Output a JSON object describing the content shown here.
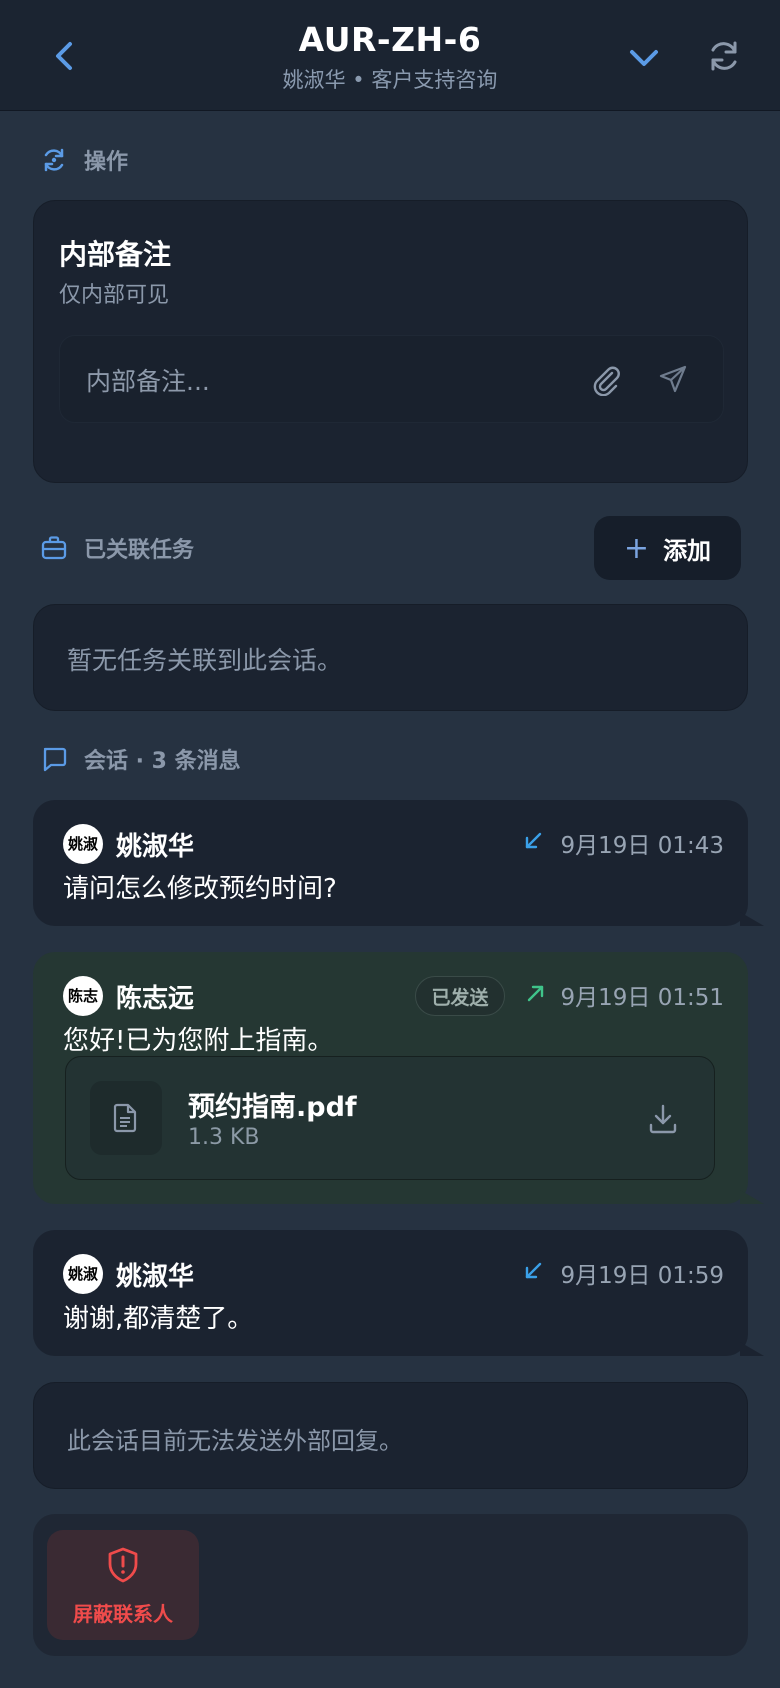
{
  "header": {
    "title": "AUR-ZH-6",
    "subtitle": "姚淑华 • 客户支持咨询"
  },
  "actions_section": {
    "label": "操作"
  },
  "internal_note": {
    "title": "内部备注",
    "subtitle": "仅内部可见",
    "placeholder": "内部备注..."
  },
  "tasks_section": {
    "label": "已关联任务",
    "add_label": "添加",
    "empty_text": "暂无任务关联到此会话。"
  },
  "conversation": {
    "label": "会话 · 3 条消息",
    "messages": [
      {
        "sender": "姚淑华",
        "avatar_text": "姚淑",
        "direction": "incoming",
        "time": "9月19日 01:43",
        "body": "请问怎么修改预约时间?"
      },
      {
        "sender": "陈志远",
        "avatar_text": "陈志",
        "direction": "outgoing",
        "status": "已发送",
        "time": "9月19日 01:51",
        "body": "您好!已为您附上指南。",
        "attachment": {
          "name": "预约指南.pdf",
          "size": "1.3 KB"
        }
      },
      {
        "sender": "姚淑华",
        "avatar_text": "姚淑",
        "direction": "incoming",
        "time": "9月19日 01:59",
        "body": "谢谢,都清楚了。"
      }
    ]
  },
  "no_reply_notice": "此会话目前无法发送外部回复。",
  "block_contact": {
    "label": "屏蔽联系人"
  },
  "colors": {
    "background": "#263241",
    "card": "#1b2330",
    "outgoing_bubble": "#253733",
    "accent": "#5b9be6",
    "incoming_arrow": "#3aa0e8",
    "outgoing_arrow": "#3fc48a",
    "danger": "#ef4b4b"
  }
}
